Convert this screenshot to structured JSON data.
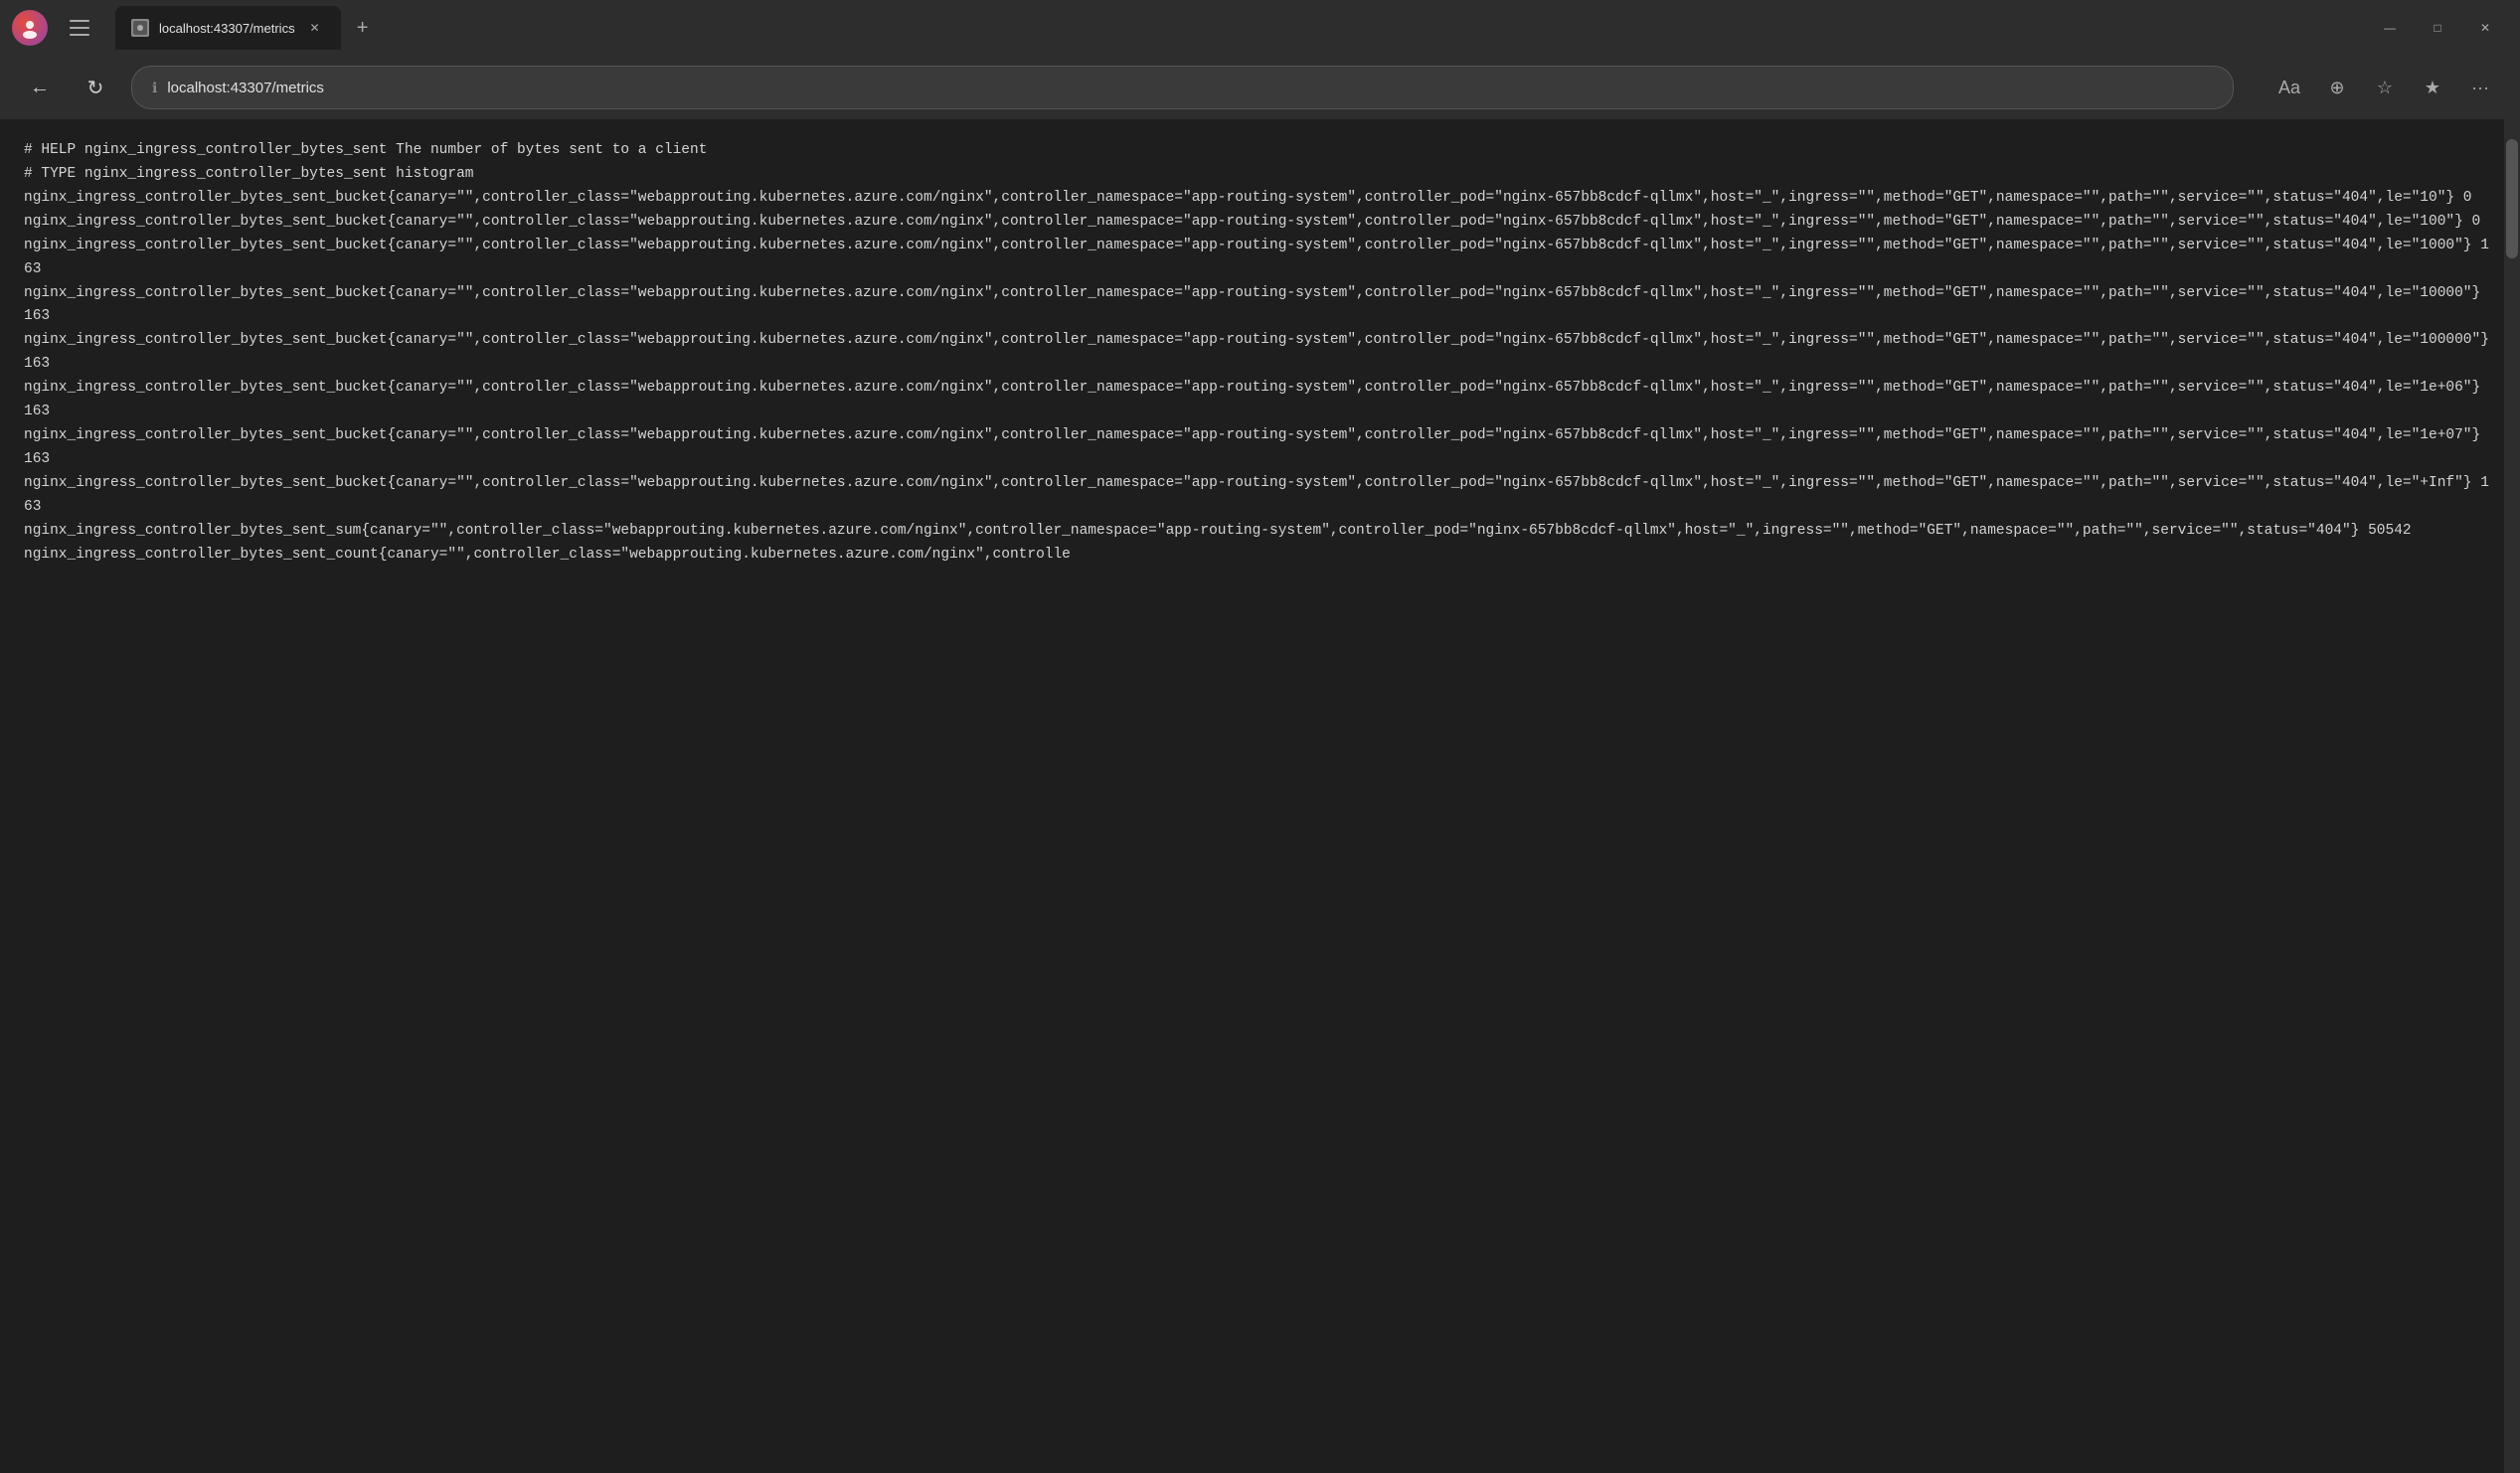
{
  "titlebar": {
    "tab_title": "localhost:43307/metrics",
    "new_tab_label": "+",
    "minimize_label": "—",
    "maximize_label": "□",
    "close_label": "✕"
  },
  "addressbar": {
    "back_label": "←",
    "refresh_label": "↻",
    "url": "localhost:43307/metrics",
    "reader_label": "Aa",
    "zoom_label": "⊕",
    "favorites_label": "☆",
    "collections_label": "★",
    "more_label": "···"
  },
  "content": {
    "text": "# HELP nginx_ingress_controller_bytes_sent The number of bytes sent to a client\n# TYPE nginx_ingress_controller_bytes_sent histogram\nnginx_ingress_controller_bytes_sent_bucket{canary=\"\",controller_class=\"webapprouting.kubernetes.azure.com/nginx\",controller_namespace=\"app-routing-system\",controller_pod=\"nginx-657bb8cdcf-qllmx\",host=\"_\",ingress=\"\",method=\"GET\",namespace=\"\",path=\"\",service=\"\",status=\"404\",le=\"10\"} 0\nnginx_ingress_controller_bytes_sent_bucket{canary=\"\",controller_class=\"webapprouting.kubernetes.azure.com/nginx\",controller_namespace=\"app-routing-system\",controller_pod=\"nginx-657bb8cdcf-qllmx\",host=\"_\",ingress=\"\",method=\"GET\",namespace=\"\",path=\"\",service=\"\",status=\"404\",le=\"100\"} 0\nnginx_ingress_controller_bytes_sent_bucket{canary=\"\",controller_class=\"webapprouting.kubernetes.azure.com/nginx\",controller_namespace=\"app-routing-system\",controller_pod=\"nginx-657bb8cdcf-qllmx\",host=\"_\",ingress=\"\",method=\"GET\",namespace=\"\",path=\"\",service=\"\",status=\"404\",le=\"1000\"} 163\nnginx_ingress_controller_bytes_sent_bucket{canary=\"\",controller_class=\"webapprouting.kubernetes.azure.com/nginx\",controller_namespace=\"app-routing-system\",controller_pod=\"nginx-657bb8cdcf-qllmx\",host=\"_\",ingress=\"\",method=\"GET\",namespace=\"\",path=\"\",service=\"\",status=\"404\",le=\"10000\"} 163\nnginx_ingress_controller_bytes_sent_bucket{canary=\"\",controller_class=\"webapprouting.kubernetes.azure.com/nginx\",controller_namespace=\"app-routing-system\",controller_pod=\"nginx-657bb8cdcf-qllmx\",host=\"_\",ingress=\"\",method=\"GET\",namespace=\"\",path=\"\",service=\"\",status=\"404\",le=\"100000\"} 163\nnginx_ingress_controller_bytes_sent_bucket{canary=\"\",controller_class=\"webapprouting.kubernetes.azure.com/nginx\",controller_namespace=\"app-routing-system\",controller_pod=\"nginx-657bb8cdcf-qllmx\",host=\"_\",ingress=\"\",method=\"GET\",namespace=\"\",path=\"\",service=\"\",status=\"404\",le=\"1e+06\"} 163\nnginx_ingress_controller_bytes_sent_bucket{canary=\"\",controller_class=\"webapprouting.kubernetes.azure.com/nginx\",controller_namespace=\"app-routing-system\",controller_pod=\"nginx-657bb8cdcf-qllmx\",host=\"_\",ingress=\"\",method=\"GET\",namespace=\"\",path=\"\",service=\"\",status=\"404\",le=\"1e+07\"} 163\nnginx_ingress_controller_bytes_sent_bucket{canary=\"\",controller_class=\"webapprouting.kubernetes.azure.com/nginx\",controller_namespace=\"app-routing-system\",controller_pod=\"nginx-657bb8cdcf-qllmx\",host=\"_\",ingress=\"\",method=\"GET\",namespace=\"\",path=\"\",service=\"\",status=\"404\",le=\"+Inf\"} 163\nnginx_ingress_controller_bytes_sent_sum{canary=\"\",controller_class=\"webapprouting.kubernetes.azure.com/nginx\",controller_namespace=\"app-routing-system\",controller_pod=\"nginx-657bb8cdcf-qllmx\",host=\"_\",ingress=\"\",method=\"GET\",namespace=\"\",path=\"\",service=\"\",status=\"404\"} 50542\nnginx_ingress_controller_bytes_sent_count{canary=\"\",controller_class=\"webapprouting.kubernetes.azure.com/nginx\",controlle"
  }
}
